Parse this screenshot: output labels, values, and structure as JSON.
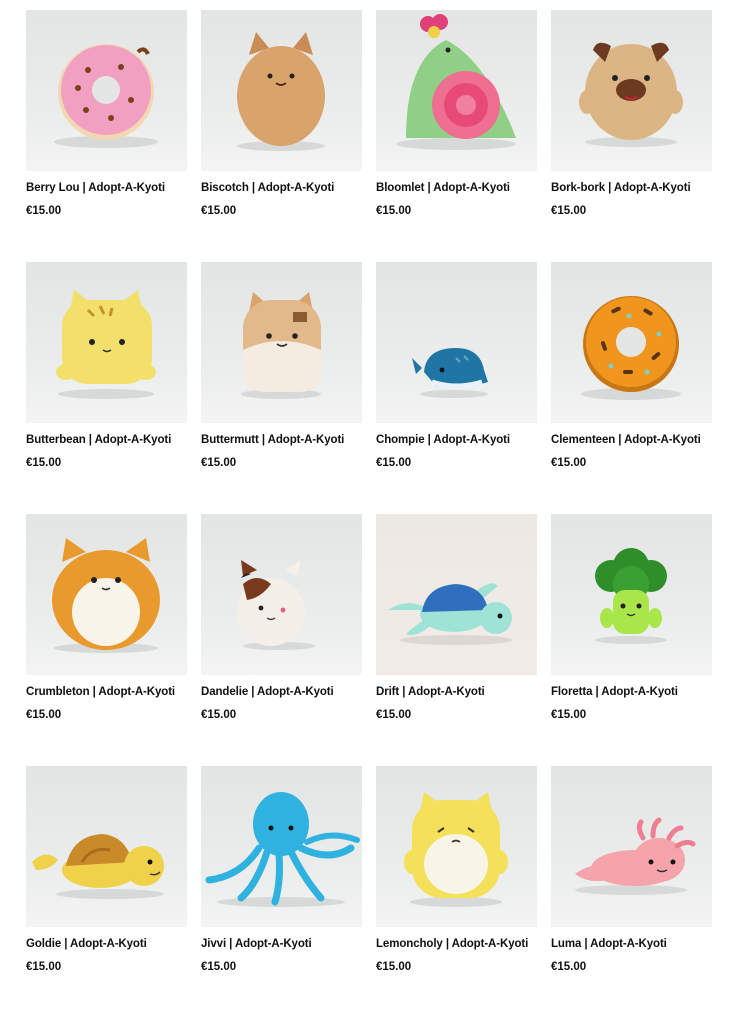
{
  "products": [
    {
      "name": "Berry Lou | Adopt-A-Kyoti",
      "price": "€15.00",
      "image": "pink-donut-plush",
      "color": "#f1a0c2"
    },
    {
      "name": "Biscotch | Adopt-A-Kyoti",
      "price": "€15.00",
      "image": "tan-cat-plush",
      "color": "#d9a36c"
    },
    {
      "name": "Bloomlet | Adopt-A-Kyoti",
      "price": "€15.00",
      "image": "green-snail-bird-plush",
      "color": "#8fcf86"
    },
    {
      "name": "Bork-bork | Adopt-A-Kyoti",
      "price": "€15.00",
      "image": "pug-dog-plush",
      "color": "#dcb585"
    },
    {
      "name": "Butterbean | Adopt-A-Kyoti",
      "price": "€15.00",
      "image": "yellow-cat-plush",
      "color": "#f2e06a"
    },
    {
      "name": "Buttermutt | Adopt-A-Kyoti",
      "price": "€15.00",
      "image": "shiba-dog-plush",
      "color": "#e2b98a"
    },
    {
      "name": "Chompie | Adopt-A-Kyoti",
      "price": "€15.00",
      "image": "blue-whale-plush",
      "color": "#1f76a5"
    },
    {
      "name": "Clementeen | Adopt-A-Kyoti",
      "price": "€15.00",
      "image": "orange-donut-plush",
      "color": "#f0961e"
    },
    {
      "name": "Crumbleton | Adopt-A-Kyoti",
      "price": "€15.00",
      "image": "orange-cat-plush",
      "color": "#e89a2c"
    },
    {
      "name": "Dandelie | Adopt-A-Kyoti",
      "price": "€15.00",
      "image": "calico-cat-plush",
      "color": "#f4efe8"
    },
    {
      "name": "Drift | Adopt-A-Kyoti",
      "price": "€15.00",
      "image": "sea-turtle-plush",
      "color": "#2f6fbe"
    },
    {
      "name": "Floretta | Adopt-A-Kyoti",
      "price": "€15.00",
      "image": "broccoli-plush",
      "color": "#5fbd3a"
    },
    {
      "name": "Goldie | Adopt-A-Kyoti",
      "price": "€15.00",
      "image": "yellow-turtle-plush",
      "color": "#f0d14a"
    },
    {
      "name": "Jivvi | Adopt-A-Kyoti",
      "price": "€15.00",
      "image": "blue-octopus-plush",
      "color": "#2fb2df"
    },
    {
      "name": "Lemoncholy | Adopt-A-Kyoti",
      "price": "€15.00",
      "image": "lemon-cat-plush",
      "color": "#f5e05a"
    },
    {
      "name": "Luma | Adopt-A-Kyoti",
      "price": "€15.00",
      "image": "pink-axolotl-plush",
      "color": "#f4a4aa"
    }
  ]
}
